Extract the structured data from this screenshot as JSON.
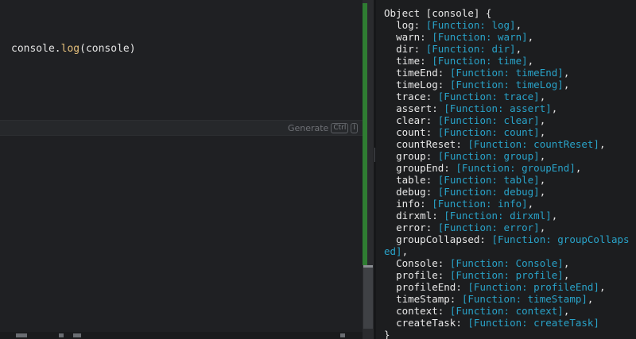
{
  "editor": {
    "code": {
      "object": "console",
      "method": "log",
      "arg": "console"
    },
    "generate_hint": {
      "label": "Generate",
      "shortcut_mod": "Ctrl",
      "shortcut_key": "I"
    }
  },
  "console_output": {
    "open": "Object [console] {",
    "close": "}",
    "entries": [
      {
        "key": "log",
        "value": "[Function: log]"
      },
      {
        "key": "warn",
        "value": "[Function: warn]"
      },
      {
        "key": "dir",
        "value": "[Function: dir]"
      },
      {
        "key": "time",
        "value": "[Function: time]"
      },
      {
        "key": "timeEnd",
        "value": "[Function: timeEnd]"
      },
      {
        "key": "timeLog",
        "value": "[Function: timeLog]"
      },
      {
        "key": "trace",
        "value": "[Function: trace]"
      },
      {
        "key": "assert",
        "value": "[Function: assert]"
      },
      {
        "key": "clear",
        "value": "[Function: clear]"
      },
      {
        "key": "count",
        "value": "[Function: count]"
      },
      {
        "key": "countReset",
        "value": "[Function: countReset]"
      },
      {
        "key": "group",
        "value": "[Function: group]"
      },
      {
        "key": "groupEnd",
        "value": "[Function: groupEnd]"
      },
      {
        "key": "table",
        "value": "[Function: table]"
      },
      {
        "key": "debug",
        "value": "[Function: debug]"
      },
      {
        "key": "info",
        "value": "[Function: info]"
      },
      {
        "key": "dirxml",
        "value": "[Function: dirxml]"
      },
      {
        "key": "error",
        "value": "[Function: error]"
      },
      {
        "key": "groupCollapsed",
        "value": "[Function: groupCollapsed]"
      },
      {
        "key": "Console",
        "value": "[Function: Console]"
      },
      {
        "key": "profile",
        "value": "[Function: profile]"
      },
      {
        "key": "profileEnd",
        "value": "[Function: profileEnd]"
      },
      {
        "key": "timeStamp",
        "value": "[Function: timeStamp]"
      },
      {
        "key": "context",
        "value": "[Function: context]"
      },
      {
        "key": "createTask",
        "value": "[Function: createTask]"
      }
    ]
  },
  "colors": {
    "key": "#e8e8e8",
    "function_value": "#29a3c9",
    "method": "#e6c07b",
    "change_marker": "#2f7d32"
  }
}
